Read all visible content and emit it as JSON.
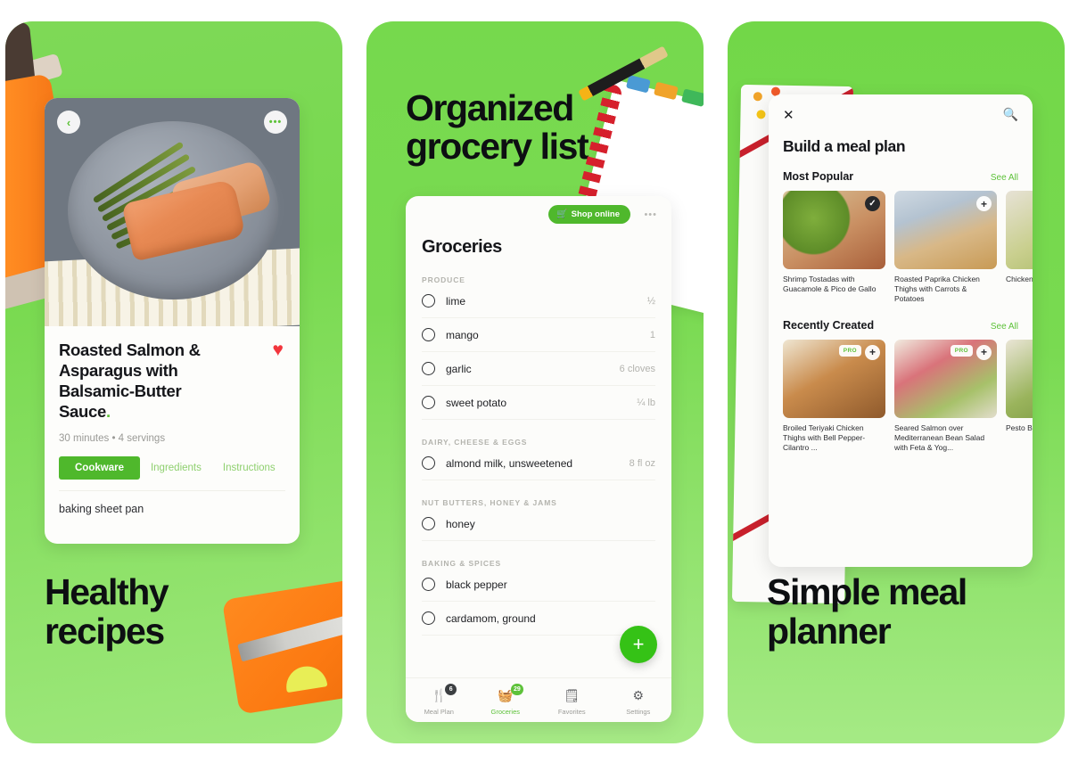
{
  "panel1": {
    "heading": "Healthy\nrecipes",
    "heading_lines": [
      "Healthy",
      "recipes"
    ],
    "back_icon": "chevron-left-icon",
    "more_icon": "more-options-icon",
    "recipe": {
      "title": "Roasted Salmon & Asparagus with Balsamic-Butter Sauce",
      "title_dot": ".",
      "meta": "30 minutes • 4 servings",
      "favorite_icon": "heart-icon",
      "tabs": [
        {
          "label": "Cookware",
          "active": true
        },
        {
          "label": "Ingredients",
          "active": false
        },
        {
          "label": "Instructions",
          "active": false
        }
      ],
      "cookware_items": [
        "baking sheet pan"
      ]
    }
  },
  "panel2": {
    "heading_lines": [
      "Organized",
      "grocery list"
    ],
    "card": {
      "title": "Groceries",
      "shop_button": "Shop online",
      "shop_icon": "shopping-cart-icon",
      "more_icon": "more-options-icon",
      "add_icon": "plus-icon",
      "sections": [
        {
          "label": "PRODUCE",
          "items": [
            {
              "name": "lime",
              "qty": "½"
            },
            {
              "name": "mango",
              "qty": "1"
            },
            {
              "name": "garlic",
              "qty": "6 cloves"
            },
            {
              "name": "sweet potato",
              "qty": "¼ lb"
            }
          ]
        },
        {
          "label": "DAIRY, CHEESE & EGGS",
          "items": [
            {
              "name": "almond milk, unsweetened",
              "qty": "8 fl oz"
            }
          ]
        },
        {
          "label": "NUT BUTTERS, HONEY & JAMS",
          "items": [
            {
              "name": "honey",
              "qty": ""
            }
          ]
        },
        {
          "label": "BAKING & SPICES",
          "items": [
            {
              "name": "black pepper",
              "qty": ""
            },
            {
              "name": "cardamom, ground",
              "qty": ""
            }
          ]
        }
      ],
      "nav": [
        {
          "label": "Meal Plan",
          "icon": "utensils-icon",
          "badge": "6",
          "badge_color": "#3c3f42",
          "active": false
        },
        {
          "label": "Groceries",
          "icon": "basket-icon",
          "badge": "29",
          "badge_color": "#5ec23a",
          "active": true
        },
        {
          "label": "Favorites",
          "icon": "bookmark-heart-icon",
          "badge": "",
          "badge_color": "",
          "active": false
        },
        {
          "label": "Settings",
          "icon": "gear-icon",
          "badge": "",
          "badge_color": "",
          "active": false
        }
      ]
    }
  },
  "panel3": {
    "heading_lines": [
      "Simple meal",
      "planner"
    ],
    "card": {
      "close_icon": "close-icon",
      "search_icon": "search-icon",
      "title": "Build a meal plan",
      "sections": [
        {
          "title": "Most Popular",
          "see_all": "See All",
          "cards": [
            {
              "caption": "Shrimp Tostadas with Guacamole & Pico de Gallo",
              "badge": "check",
              "pro": false
            },
            {
              "caption": "Roasted Paprika Chicken Thighs with Carrots & Potatoes",
              "badge": "plus",
              "pro": false
            },
            {
              "caption": "Chicken Gyros Salad",
              "badge": "plus",
              "pro": false
            }
          ]
        },
        {
          "title": "Recently Created",
          "see_all": "See All",
          "cards": [
            {
              "caption": "Broiled Teriyaki Chicken Thighs with Bell Pepper-Cilantro ...",
              "badge": "plus",
              "pro": true
            },
            {
              "caption": "Seared Salmon over Mediterranean Bean Salad with Feta & Yog...",
              "badge": "plus",
              "pro": true
            },
            {
              "caption": "Pesto Bowls",
              "badge": "plus",
              "pro": true
            }
          ]
        }
      ],
      "pro_label": "PRO"
    }
  },
  "colors": {
    "brand_green": "#5ec23a",
    "panel_green": "#7ed957",
    "accent_orange": "#ff8a1f",
    "heart_red": "#f2353c",
    "button_green": "#4fb82c"
  }
}
